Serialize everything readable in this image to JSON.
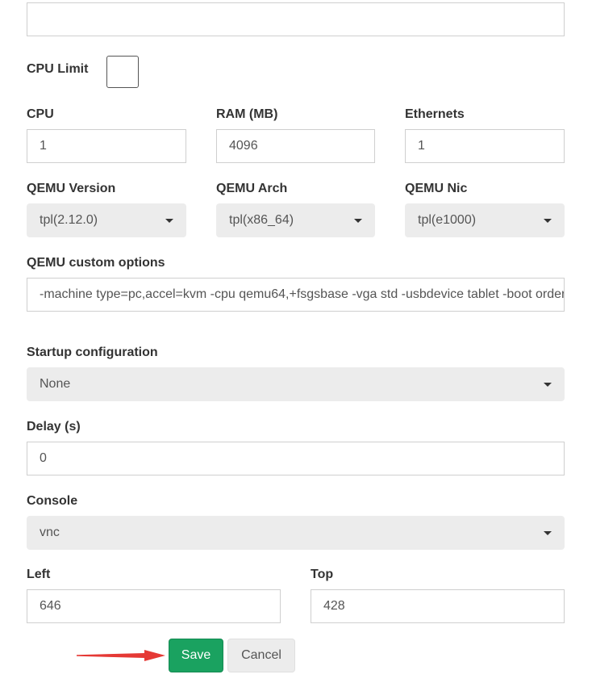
{
  "top_field": {
    "value": ""
  },
  "cpu_limit": {
    "label": "CPU Limit",
    "checked": false
  },
  "cpu": {
    "label": "CPU",
    "value": "1"
  },
  "ram": {
    "label": "RAM (MB)",
    "value": "4096"
  },
  "ethernets": {
    "label": "Ethernets",
    "value": "1"
  },
  "qemu_version": {
    "label": "QEMU Version",
    "value": "tpl(2.12.0)"
  },
  "qemu_arch": {
    "label": "QEMU Arch",
    "value": "tpl(x86_64)"
  },
  "qemu_nic": {
    "label": "QEMU Nic",
    "value": "tpl(e1000)"
  },
  "qemu_options": {
    "label": "QEMU custom options",
    "value": "-machine type=pc,accel=kvm -cpu qemu64,+fsgsbase -vga std -usbdevice tablet -boot order=cd"
  },
  "startup_config": {
    "label": "Startup configuration",
    "value": "None"
  },
  "delay": {
    "label": "Delay (s)",
    "value": "0"
  },
  "console": {
    "label": "Console",
    "value": "vnc"
  },
  "left": {
    "label": "Left",
    "value": "646"
  },
  "top": {
    "label": "Top",
    "value": "428"
  },
  "buttons": {
    "save": "Save",
    "cancel": "Cancel"
  },
  "colors": {
    "save_bg": "#1aa260",
    "select_bg": "#ececec",
    "arrow": "#e53935"
  }
}
